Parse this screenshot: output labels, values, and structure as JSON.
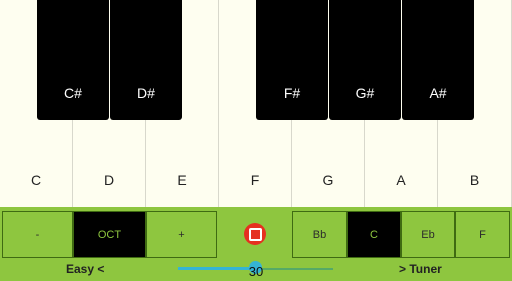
{
  "piano": {
    "white_keys": [
      "C",
      "D",
      "E",
      "F",
      "G",
      "A",
      "B"
    ],
    "black_keys": [
      "C#",
      "D#",
      "F#",
      "G#",
      "A#"
    ]
  },
  "controls": {
    "octave": {
      "minus": "-",
      "label": "OCT",
      "plus": "+"
    },
    "keys": [
      "Bb",
      "C",
      "Eb",
      "F"
    ],
    "selected_key": "C"
  },
  "bottom": {
    "mode_label": "Easy  <",
    "slider_value": "30",
    "tuner_link": "> Tuner"
  },
  "colors": {
    "accent": "#8ec63f",
    "record": "#e53020",
    "slider": "#35b4d4"
  }
}
